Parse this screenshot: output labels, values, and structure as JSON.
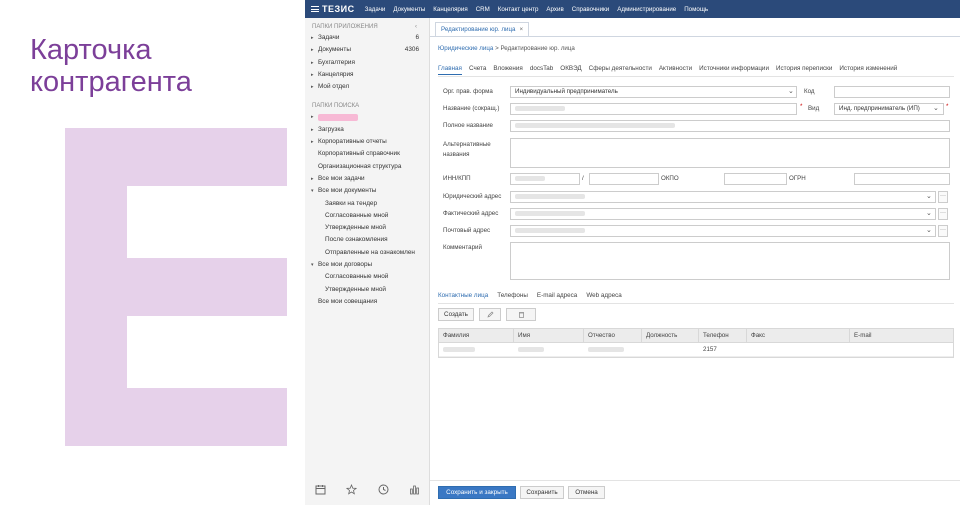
{
  "slide": {
    "title_line1": "Карточка",
    "title_line2": "контрагента",
    "accent_color": "#7c3f99",
    "letter_color": "#e6d1ea"
  },
  "app": {
    "logo": "ТЕЗИС",
    "menu": [
      "Задачи",
      "Документы",
      "Канцелярия",
      "CRM",
      "Контакт центр",
      "Архив",
      "Справочники",
      "Администрирование",
      "Помощь"
    ]
  },
  "sidebar": {
    "apps_header": "ПАПКИ ПРИЛОЖЕНИЯ",
    "collapse_glyph": "‹",
    "apps": [
      {
        "label": "Задачи",
        "count": "6"
      },
      {
        "label": "Документы",
        "count": "4306"
      },
      {
        "label": "Бухгалтерия",
        "count": ""
      },
      {
        "label": "Канцелярия",
        "count": ""
      },
      {
        "label": "Мой отдел",
        "count": ""
      }
    ],
    "search_header": "ПАПКИ ПОИСКА",
    "search": [
      {
        "label": "Загрузка",
        "level": 1,
        "arrow": "▸"
      },
      {
        "label": "Корпоративные отчеты",
        "level": 1,
        "arrow": "▸"
      },
      {
        "label": "Корпоративный справочник",
        "level": 2,
        "arrow": ""
      },
      {
        "label": "Организационная структура",
        "level": 2,
        "arrow": ""
      },
      {
        "label": "Все мои задачи",
        "level": 1,
        "arrow": "▸"
      },
      {
        "label": "Все мои документы",
        "level": 1,
        "arrow": "▾"
      },
      {
        "label": "Заявки на тендер",
        "level": 3,
        "arrow": ""
      },
      {
        "label": "Согласованные мной",
        "level": 3,
        "arrow": ""
      },
      {
        "label": "Утвержденные мной",
        "level": 3,
        "arrow": ""
      },
      {
        "label": "После ознакомления",
        "level": 3,
        "arrow": ""
      },
      {
        "label": "Отправленные на ознакомлен",
        "level": 3,
        "arrow": ""
      },
      {
        "label": "Все мои договоры",
        "level": 1,
        "arrow": "▾"
      },
      {
        "label": "Согласованные мной",
        "level": 3,
        "arrow": ""
      },
      {
        "label": "Утвержденные мной",
        "level": 3,
        "arrow": ""
      },
      {
        "label": "Все мои совещания",
        "level": 2,
        "arrow": ""
      }
    ]
  },
  "main": {
    "open_tab": "Редактирование юр. лица",
    "close_glyph": "×",
    "breadcrumb_link": "Юридические лица",
    "breadcrumb_sep": ">",
    "breadcrumb_current": "Редактирование юр. лица",
    "subtabs": [
      "Главная",
      "Счета",
      "Вложения",
      "docsTab",
      "ОКВЭД",
      "Сферы деятельности",
      "Активности",
      "Источники информации",
      "История переписки",
      "История изменений"
    ],
    "form": {
      "legal_form_label": "Орг. прав. форма",
      "legal_form_value": "Индивидуальный предприниматель",
      "code_label": "Код",
      "short_name_label": "Название (сокращ.)",
      "required_mark": "*",
      "type_label": "Вид",
      "type_value": "Инд. предприниматель (ИП)",
      "full_name_label": "Полное название",
      "alt_name_label_1": "Альтернативные",
      "alt_name_label_2": "названия",
      "inn_label": "ИНН/КПП",
      "inn_sep": "/",
      "okpo_label": "ОКПО",
      "ogrn_label": "ОГРН",
      "legal_address_label": "Юридический адрес",
      "actual_address_label": "Фактический адрес",
      "postal_address_label": "Почтовый адрес",
      "comment_label": "Комментарий"
    },
    "contact_tabs": [
      "Контактные лица",
      "Телефоны",
      "E-mail адреса",
      "Web адреса"
    ],
    "create_button": "Создать",
    "grid_columns": [
      "Фамилия",
      "Имя",
      "Отчество",
      "Должность",
      "Телефон",
      "Факс",
      "E-mail"
    ],
    "grid_rows": [
      {
        "phone": "2157"
      }
    ],
    "save_close_button": "Сохранить и закрыть",
    "save_button": "Сохранить",
    "cancel_button": "Отмена"
  }
}
